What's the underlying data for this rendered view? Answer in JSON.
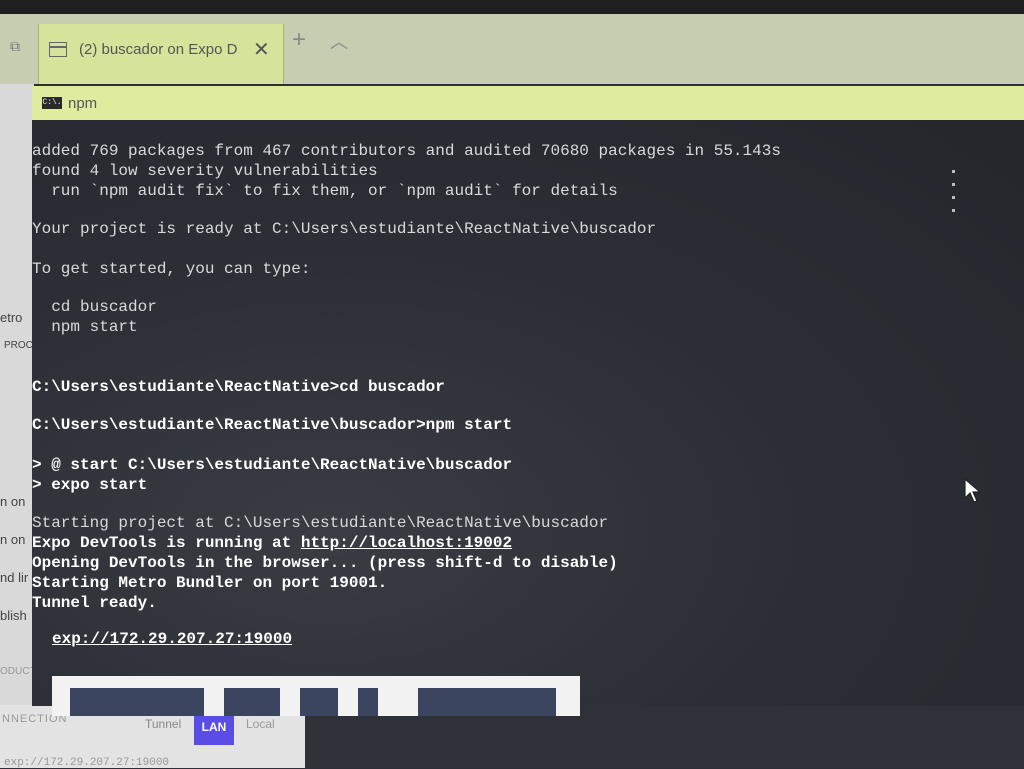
{
  "browser": {
    "tab_title": "(2) buscador on Expo D",
    "close_glyph": "✕",
    "newtab_glyph": "+",
    "chevron_glyph": "︿",
    "tabs_icon_glyph": "⧉"
  },
  "background_panel": {
    "labels": [
      "etro",
      "PROC",
      "n on",
      "n on",
      "nd lir",
      "blish",
      "ODUCT"
    ],
    "connection_label": "NNECTION",
    "tunnel": "Tunnel",
    "lan": "LAN",
    "local": "Local",
    "exp_url": "exp://172.29.207.27:19000"
  },
  "cmd": {
    "title": "npm",
    "icon_text": "C:\\.",
    "lines": [
      "added 769 packages from 467 contributors and audited 70680 packages in 55.143s",
      "found 4 low severity vulnerabilities",
      "  run `npm audit fix` to fix them, or `npm audit` for details",
      "",
      "Your project is ready at C:\\Users\\estudiante\\ReactNative\\buscador",
      "",
      "To get started, you can type:",
      "",
      "  cd buscador",
      "  npm start",
      "",
      "",
      "C:\\Users\\estudiante\\ReactNative>cd buscador",
      "",
      "C:\\Users\\estudiante\\ReactNative\\buscador>npm start",
      "",
      "> @ start C:\\Users\\estudiante\\ReactNative\\buscador",
      "> expo start",
      "",
      "Starting project at C:\\Users\\estudiante\\ReactNative\\buscador",
      "Expo DevTools is running at ",
      "Opening DevTools in the browser... (press shift-d to disable)",
      "Starting Metro Bundler on port 19001.",
      "Tunnel ready.",
      "",
      "  exp://172.29.207.27:19000"
    ],
    "devtools_url": "http://localhost:19002",
    "exp_link": "exp://172.29.207.27:19000"
  }
}
